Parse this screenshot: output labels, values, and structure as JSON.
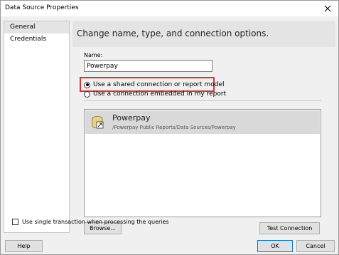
{
  "window": {
    "title": "Data Source Properties"
  },
  "sidebar": {
    "items": [
      {
        "label": "General",
        "selected": true
      },
      {
        "label": "Credentials",
        "selected": false
      }
    ]
  },
  "main": {
    "header": "Change name, type, and connection options.",
    "name_label": "Name:",
    "name_value": "Powerpay",
    "radio_shared": {
      "label": "Use a shared connection or report model",
      "checked": true
    },
    "radio_embedded": {
      "label": "Use a connection embedded in my report",
      "checked": false
    },
    "data_source": {
      "name": "Powerpay",
      "path": "/Powerpay Public Reports/Data Sources/Powerpay",
      "icon": "shared-data-source-icon"
    },
    "browse_label": "Browse...",
    "test_connection_label": "Test Connection",
    "single_transaction": {
      "label": "Use single transaction when processing the queries",
      "checked": false
    }
  },
  "footer": {
    "help_label": "Help",
    "ok_label": "OK",
    "cancel_label": "Cancel"
  },
  "colors": {
    "highlight": "#e03131",
    "default_button_border": "#0078d7"
  }
}
